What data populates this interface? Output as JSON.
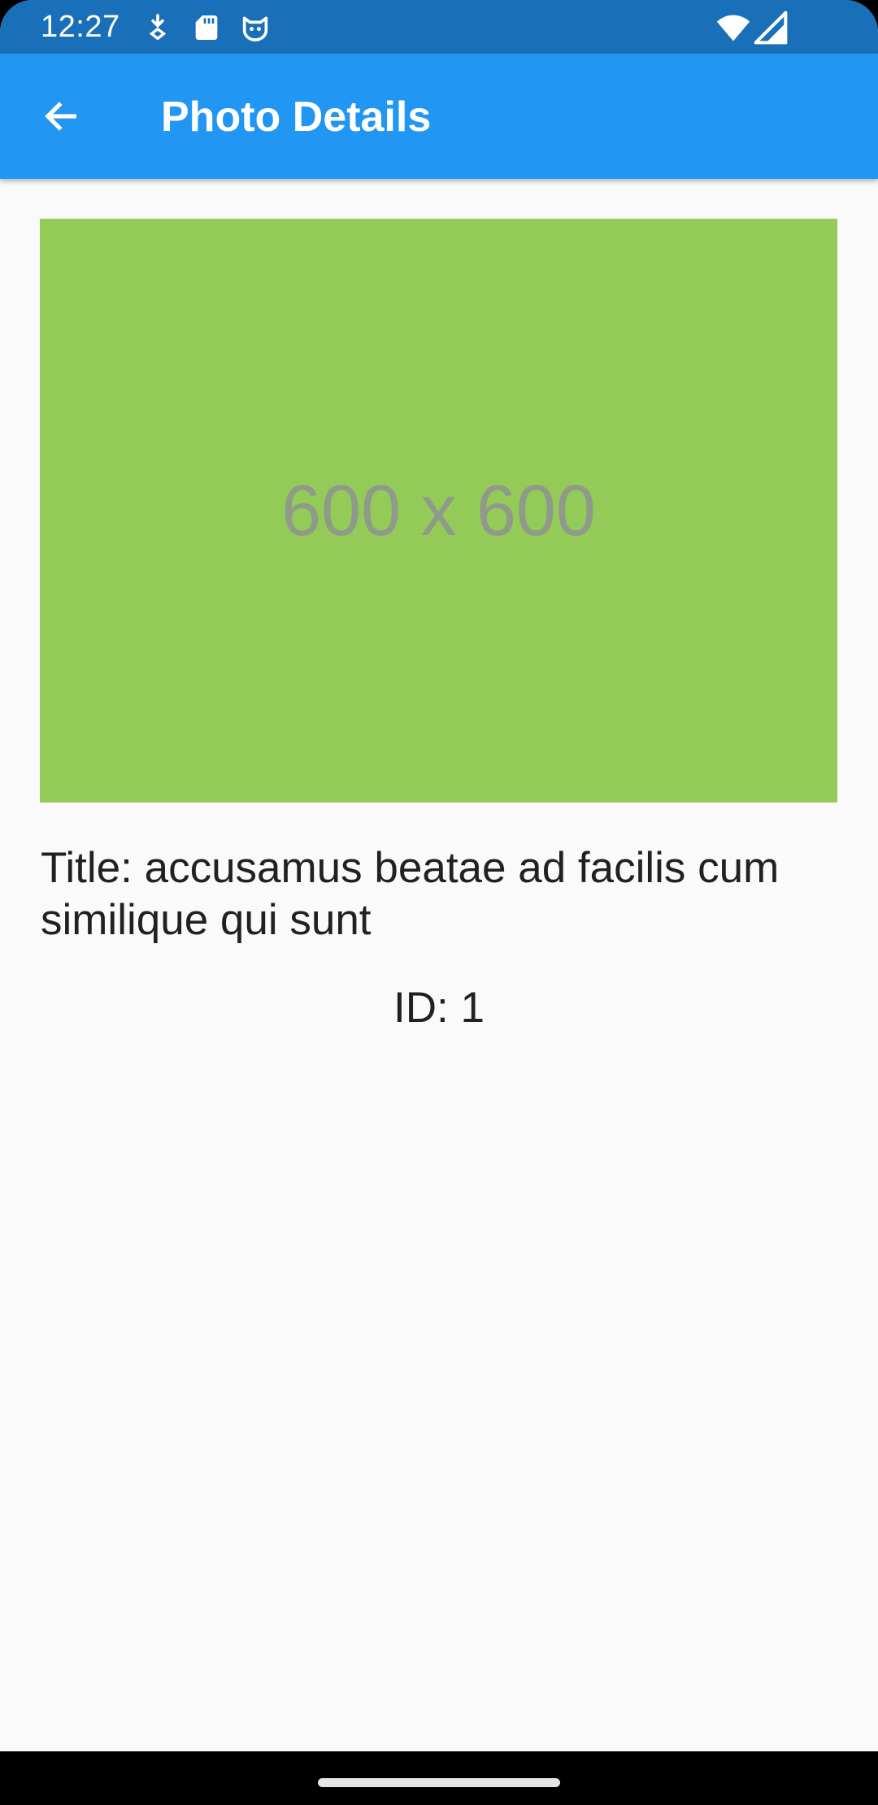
{
  "status_bar": {
    "time": "12:27",
    "icons": [
      "download-indicator-icon",
      "sd-card-icon",
      "cat-app-icon",
      "wifi-icon",
      "cell-signal-icon"
    ],
    "background_color": "#1a70b8"
  },
  "app_bar": {
    "title": "Photo Details",
    "back_icon": "arrow-back-icon",
    "background_color": "#2196f3"
  },
  "photo": {
    "placeholder_text": "600 x 600",
    "background_color": "#94ca57"
  },
  "details": {
    "title_line": "Title: accusamus beatae ad facilis cum similique qui sunt",
    "id_line": "ID: 1"
  },
  "nav_bar": {
    "handle_icon": "gesture-handle-icon"
  }
}
